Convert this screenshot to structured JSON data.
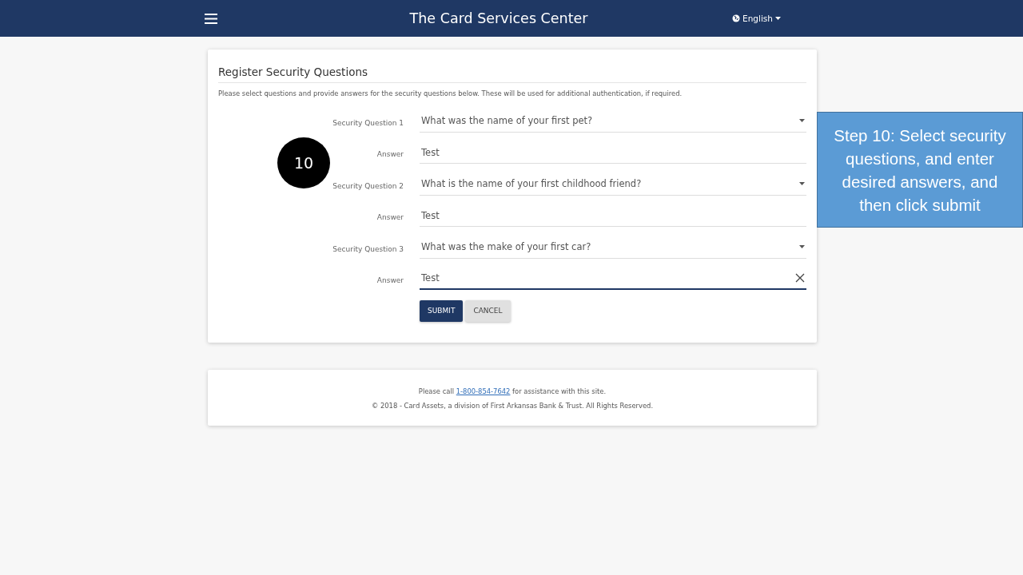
{
  "header": {
    "title": "The Card Services Center",
    "language": "English"
  },
  "form": {
    "title": "Register Security Questions",
    "intro": "Please select questions and provide answers for the security questions below. These will be used for additional authentication, if required.",
    "rows": [
      {
        "kind": "select",
        "label": "Security Question 1",
        "value": "What was the name of your first pet?"
      },
      {
        "kind": "text",
        "label": "Answer",
        "value": "Test",
        "focused": false
      },
      {
        "kind": "select",
        "label": "Security Question 2",
        "value": "What is the name of your first childhood friend?"
      },
      {
        "kind": "text",
        "label": "Answer",
        "value": "Test",
        "focused": false
      },
      {
        "kind": "select",
        "label": "Security Question 3",
        "value": "What was the make of your first car?"
      },
      {
        "kind": "text",
        "label": "Answer",
        "value": "Test",
        "focused": true
      }
    ],
    "buttons": [
      {
        "kind": "primary",
        "label": "SUBMIT"
      },
      {
        "kind": "secondary",
        "label": "CANCEL"
      }
    ]
  },
  "footer": {
    "before": "Please call",
    "phone": "1-800-854-7642",
    "after": "for assistance with this site.",
    "copyright": "© 2018 - Card Assets, a division of First Arkansas Bank & Trust. All Rights Reserved."
  },
  "annotation": {
    "step_number": "10",
    "callout": "Step 10: Select security questions, and enter desired answers, and then click submit"
  }
}
